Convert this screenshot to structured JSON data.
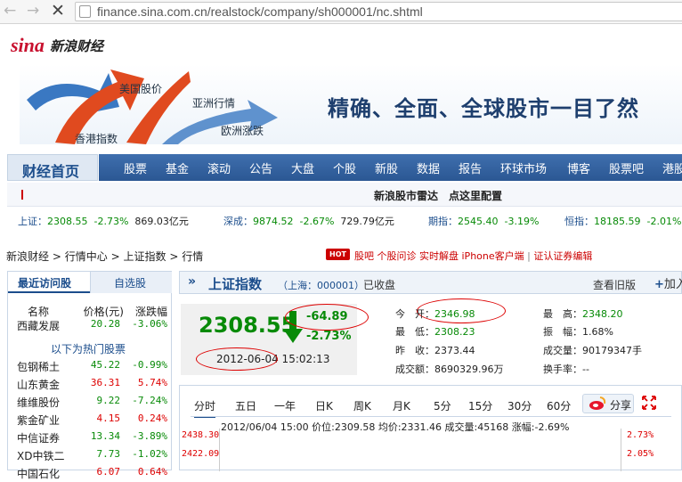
{
  "browser": {
    "url": "finance.sina.com.cn/realstock/company/sh000001/nc.shtml",
    "back": "←",
    "forward": "→",
    "stop": "✕"
  },
  "logo": {
    "sina": "sina",
    "name": "新浪财经"
  },
  "banner": {
    "labels": [
      "美国股价",
      "亚洲行情",
      "香港指数",
      "欧洲涨跌"
    ],
    "slogan": "精确、全面、全球股市一目了然"
  },
  "nav": {
    "home": "财经首页",
    "items": [
      "股票",
      "基金",
      "滚动",
      "公告",
      "大盘",
      "个股",
      "新股",
      "数据",
      "报告",
      "环球市场",
      "博客",
      "股票吧",
      "港股"
    ]
  },
  "radar": {
    "text": "新浪股市雷达　点这里配置"
  },
  "indices": [
    {
      "label": "上证：",
      "value": "2308.55",
      "chg": "-2.73%",
      "amount": "869.03亿元"
    },
    {
      "label": "深成：",
      "value": "9874.52",
      "chg": "-2.67%",
      "amount": "729.79亿元"
    },
    {
      "label": "期指：",
      "value": "2545.40",
      "chg": "-3.19%"
    },
    {
      "label": "恒指：",
      "value": "18185.59",
      "chg": "-2.01%"
    }
  ],
  "breadcrumb": [
    "新浪财经",
    "行情中心",
    "上证指数",
    "行情"
  ],
  "breadcrumb_sep": ">",
  "hot": "HOT",
  "links": [
    "股吧",
    "个股问诊",
    "实时解盘",
    "iPhone客户端",
    "证认证券编辑"
  ],
  "links_sep": "|",
  "left_panel": {
    "tab_recent": "最近访问股",
    "tab_custom": "自选股",
    "headers": [
      "名称",
      "价格(元)",
      "涨跌幅"
    ],
    "recent": [
      {
        "name": "西藏发展",
        "price": "20.28",
        "chg": "-3.06%"
      }
    ],
    "hot_title": "以下为热门股票",
    "hot": [
      {
        "name": "包钢稀土",
        "price": "45.22",
        "chg": "-0.99%"
      },
      {
        "name": "山东黄金",
        "price": "36.31",
        "chg": "5.74%"
      },
      {
        "name": "维维股份",
        "price": "9.22",
        "chg": "-7.24%"
      },
      {
        "name": "紫金矿业",
        "price": "4.15",
        "chg": "0.24%"
      },
      {
        "name": "中信证券",
        "price": "13.34",
        "chg": "-3.89%"
      },
      {
        "name": "XD中铁二",
        "price": "7.73",
        "chg": "-1.02%"
      },
      {
        "name": "中国石化",
        "price": "6.07",
        "chg": "0.64%"
      }
    ]
  },
  "index": {
    "name": "上证指数",
    "code": "（上海：000001）",
    "state": "已收盘",
    "old_version": "查看旧版",
    "add": "加入",
    "price": "2308.55",
    "change": "-64.89",
    "change_pct": "-2.73%",
    "time": "2012-06-04 15:02:13",
    "quotes": [
      {
        "label": "今　开：",
        "value": "2346.98",
        "color": "#078a07"
      },
      {
        "label": "最　低：",
        "value": "2308.23",
        "color": "#078a07"
      },
      {
        "label": "昨　收：",
        "value": "2373.44",
        "color": "#222222"
      },
      {
        "label": "成交额：",
        "value": "8690329.96万",
        "color": "#222222"
      },
      {
        "label": "最　高：",
        "value": "2348.20",
        "color": "#078a07"
      },
      {
        "label": "振　幅：",
        "value": "1.68%",
        "color": "#222222"
      },
      {
        "label": "成交量：",
        "value": "90179347手",
        "color": "#222222"
      },
      {
        "label": "换手率：",
        "value": "--",
        "color": "#222222"
      }
    ]
  },
  "chart": {
    "tabs": [
      "分时",
      "五日",
      "一年",
      "日K",
      "周K",
      "月K",
      "5分",
      "15分",
      "30分",
      "60分"
    ],
    "share": "分享",
    "info_time": "2012/06/04 15:00",
    "info_price_label": "价位:",
    "info_price": "2309.58",
    "info_avg_label": "均价:",
    "info_avg": "2331.46",
    "info_vol_label": "成交量:",
    "info_vol": "45168",
    "info_chg_label": "涨幅:",
    "info_chg": "-2.69%",
    "axis_left": [
      "2438.30",
      "2422.09"
    ],
    "axis_right": [
      "2.73%",
      "2.05%"
    ]
  },
  "colors": {
    "up": "#dd0000",
    "down": "#078a07",
    "brand": "#1b4d8c"
  }
}
